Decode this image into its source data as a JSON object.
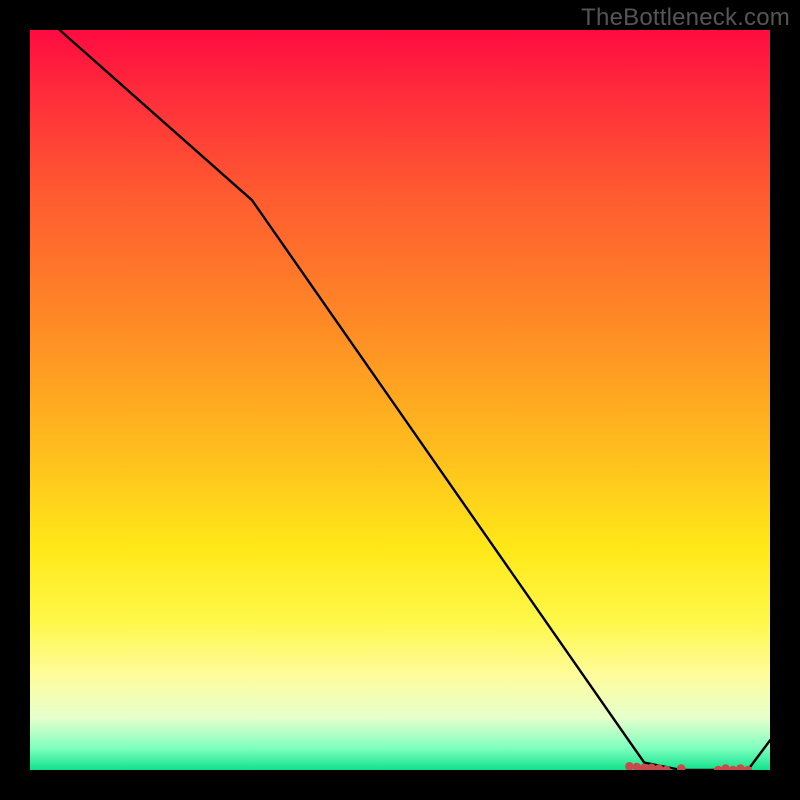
{
  "watermark": "TheBottleneck.com",
  "chart_data": {
    "type": "line",
    "title": "",
    "xlabel": "",
    "ylabel": "",
    "xlim": [
      0,
      100
    ],
    "ylim": [
      0,
      100
    ],
    "grid": false,
    "legend": false,
    "series": [
      {
        "name": "curve",
        "color": "#000000",
        "x": [
          4,
          30,
          83,
          88,
          92,
          97,
          100
        ],
        "y": [
          100,
          77,
          1,
          0,
          0,
          0,
          4
        ]
      }
    ],
    "markers": {
      "name": "bottom-dots",
      "color": "#c84a4a",
      "points": [
        {
          "x": 81,
          "y": 0.5
        },
        {
          "x": 82,
          "y": 0.4
        },
        {
          "x": 83,
          "y": 0.3
        },
        {
          "x": 84,
          "y": 0.3
        },
        {
          "x": 85,
          "y": 0.2
        },
        {
          "x": 86,
          "y": 0.0
        },
        {
          "x": 88,
          "y": 0.2
        },
        {
          "x": 93,
          "y": 0.0
        },
        {
          "x": 94,
          "y": 0.2
        },
        {
          "x": 95,
          "y": 0.0
        },
        {
          "x": 96,
          "y": 0.2
        },
        {
          "x": 97,
          "y": 0.0
        }
      ]
    },
    "background": {
      "type": "vertical-gradient",
      "top": "#ff0b41",
      "bottom": "#11e28b"
    }
  }
}
